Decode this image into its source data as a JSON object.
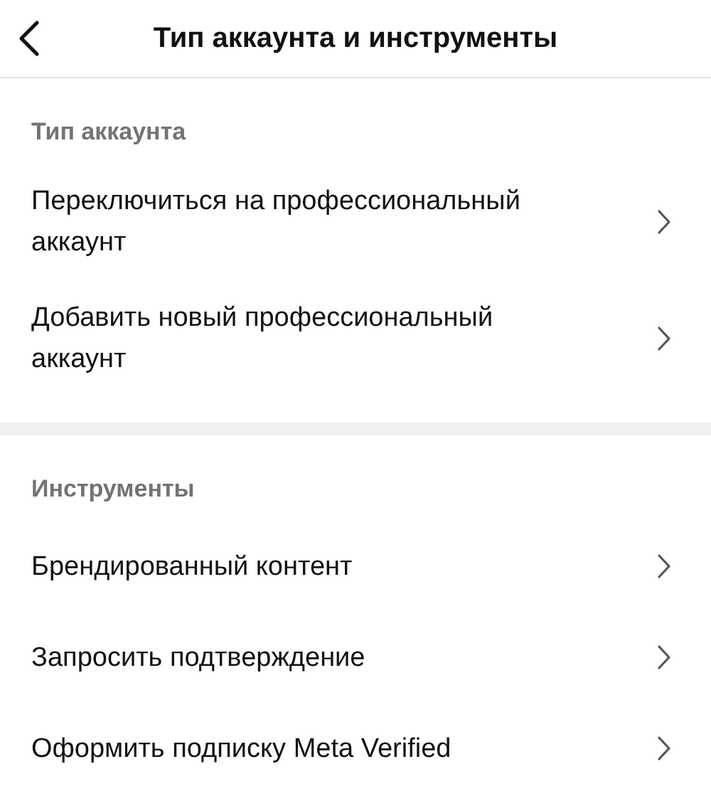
{
  "header": {
    "title": "Тип аккаунта и инструменты"
  },
  "sections": [
    {
      "title": "Тип аккаунта",
      "items": [
        {
          "label": "Переключиться на профессиональный аккаунт"
        },
        {
          "label": "Добавить новый профессиональный аккаунт"
        }
      ]
    },
    {
      "title": "Инструменты",
      "items": [
        {
          "label": "Брендированный контент"
        },
        {
          "label": "Запросить подтверждение"
        },
        {
          "label": "Оформить подписку Meta Verified"
        }
      ]
    }
  ]
}
